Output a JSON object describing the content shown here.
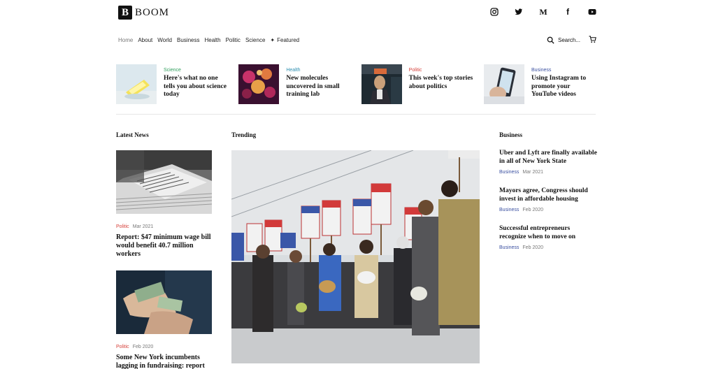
{
  "brand": {
    "logo_letter": "B",
    "name": "BOOM"
  },
  "social": {
    "icons": [
      "instagram-icon",
      "twitter-icon",
      "medium-icon",
      "facebook-icon",
      "youtube-icon"
    ],
    "medium_letter": "M",
    "facebook_letter": "f"
  },
  "nav": {
    "items": [
      "Home",
      "About",
      "World",
      "Business",
      "Health",
      "Politic",
      "Science"
    ],
    "featured_label": "Featured",
    "search_label": "Search..."
  },
  "colors": {
    "science": "#2e9e5b",
    "health": "#2e8fb0",
    "politic": "#d6403a",
    "business": "#3a4fa0"
  },
  "featured": [
    {
      "category": "Science",
      "title": "Here's what no one tells you about science today"
    },
    {
      "category": "Health",
      "title": "New molecules uncovered in small training lab"
    },
    {
      "category": "Politic",
      "title": "This week's top stories about politics"
    },
    {
      "category": "Business",
      "title": "Using Instagram to promote your YouTube videos"
    }
  ],
  "sections": {
    "latest": "Latest News",
    "trending": "Trending",
    "business": "Business"
  },
  "latest": [
    {
      "category": "Politic",
      "date": "Mar 2021",
      "title": "Report: $47 minimum wage bill would benefit 40.7 million workers"
    },
    {
      "category": "Politic",
      "date": "Feb 2020",
      "title": "Some New York incumbents lagging in fundraising: report"
    }
  ],
  "business": [
    {
      "title": "Uber and Lyft are finally available in all of New York State",
      "category": "Business",
      "date": "Mar 2021"
    },
    {
      "title": "Mayors agree, Congress should invest in affordable housing",
      "category": "Business",
      "date": "Feb 2020"
    },
    {
      "title": "Successful entrepreneurs recognize when to move on",
      "category": "Business",
      "date": "Feb 2020"
    }
  ]
}
